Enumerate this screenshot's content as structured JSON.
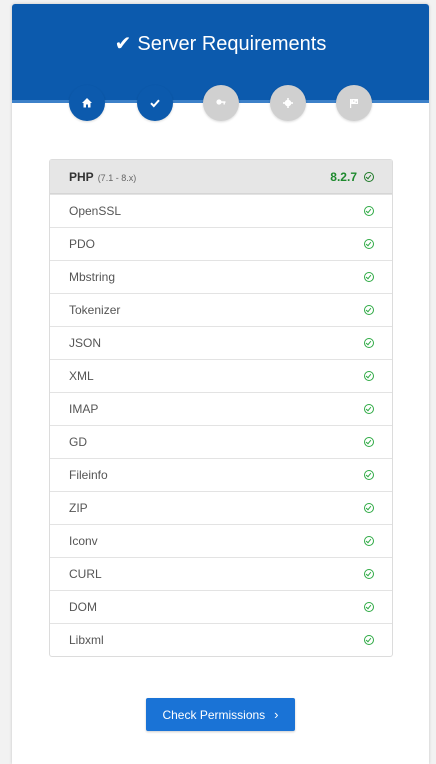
{
  "header": {
    "title": "Server Requirements",
    "color": "#0c5aad"
  },
  "steps": [
    {
      "icon": "home-icon",
      "state": "done"
    },
    {
      "icon": "check-icon",
      "state": "active"
    },
    {
      "icon": "key-icon",
      "state": "pending"
    },
    {
      "icon": "gear-icon",
      "state": "pending"
    },
    {
      "icon": "flag-icon",
      "state": "pending"
    }
  ],
  "php": {
    "label": "PHP",
    "range": "(7.1 - 8.x)",
    "version": "8.2.7"
  },
  "extensions": [
    "OpenSSL",
    "PDO",
    "Mbstring",
    "Tokenizer",
    "JSON",
    "XML",
    "IMAP",
    "GD",
    "Fileinfo",
    "ZIP",
    "Iconv",
    "CURL",
    "DOM",
    "Libxml"
  ],
  "button": {
    "label": "Check Permissions",
    "chevron": "›"
  }
}
